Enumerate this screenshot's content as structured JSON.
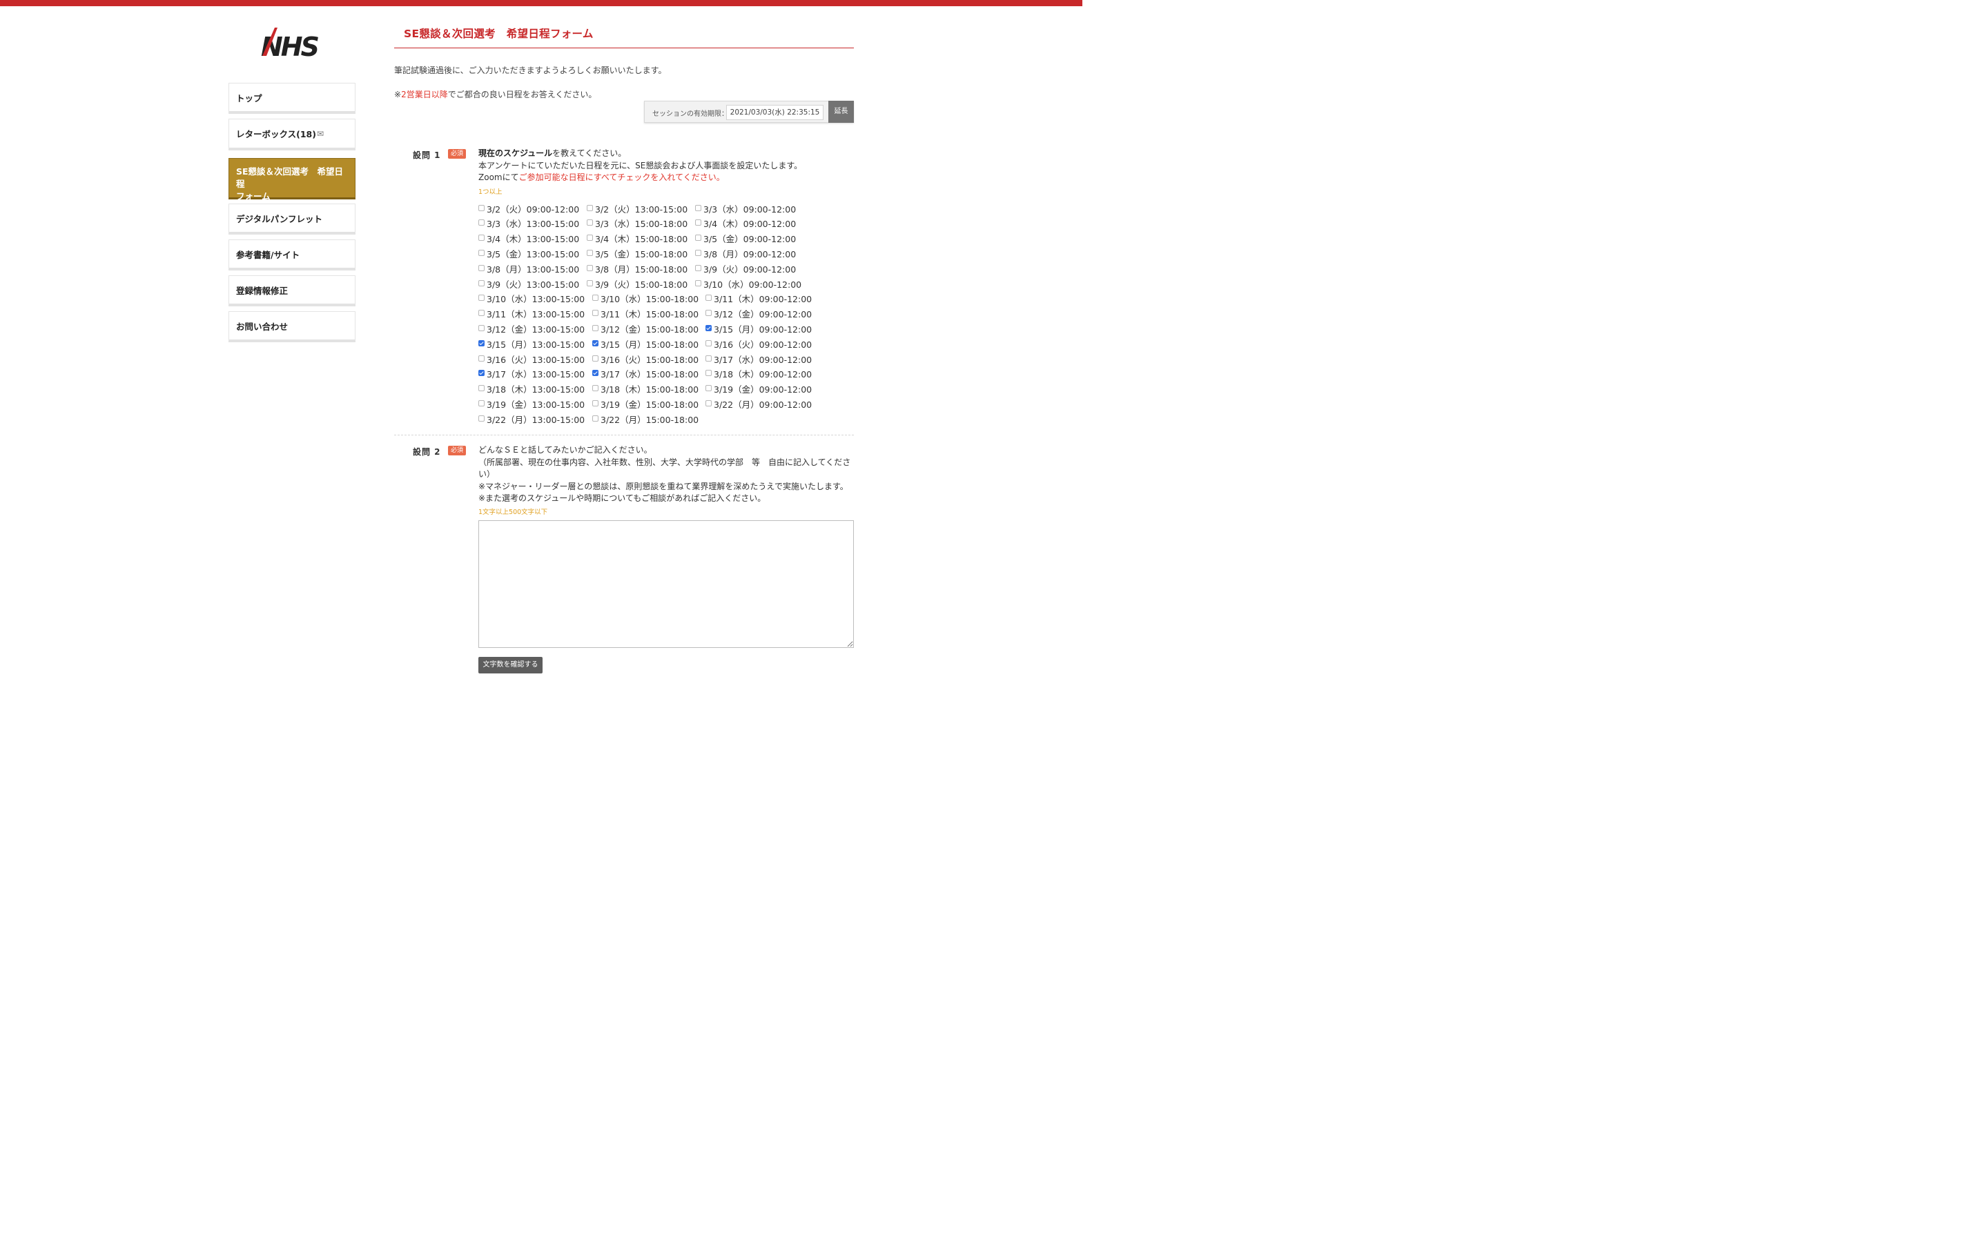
{
  "brand": {
    "logo_text": "NHS",
    "accent": "#c8282a",
    "active_nav": "#b38b28"
  },
  "sidebar": {
    "items": [
      {
        "label": "トップ"
      },
      {
        "label": "レターボックス(18)",
        "icon": "envelope-icon",
        "icon_glyph": "✉"
      },
      {
        "label_line1": "SE懇談＆次回選考　希望日程",
        "label_line2": "フォーム",
        "active": true
      },
      {
        "label": "デジタルパンフレット"
      },
      {
        "label": "参考書籍/サイト"
      },
      {
        "label": "登録情報修正"
      },
      {
        "label": "お問い合わせ"
      }
    ]
  },
  "main": {
    "title": "SE懇談＆次回選考　希望日程フォーム",
    "intro1": "筆記試験通過後に、ご入力いただきますようよろしくお願いいたします。",
    "intro2_prefix": "※",
    "intro2_red": "2営業日以降",
    "intro2_suffix": "でご都合の良い日程をお答えください。",
    "session": {
      "label": "セッションの有効期限：",
      "time": "2021/03/03(水) 22:35:15",
      "extend": "延長"
    },
    "q1": {
      "label": "設問 1",
      "required": "必須",
      "line1_bold": "現在のスケジュール",
      "line1_rest": "を教えてください。",
      "line2": "本アンケートにていただいた日程を元に、SE懇談会および人事面談を設定いたします。",
      "line3_prefix": "Zoomにて",
      "line3_red": "ご参加可能な日程にすべてチェックを入れてください。",
      "hint": "1つ以上",
      "options": [
        {
          "label": "3/2（火）09:00-12:00",
          "checked": false
        },
        {
          "label": "3/2（火）13:00-15:00",
          "checked": false
        },
        {
          "label": "3/3（水）09:00-12:00",
          "checked": false
        },
        {
          "label": "3/3（水）13:00-15:00",
          "checked": false
        },
        {
          "label": "3/3（水）15:00-18:00",
          "checked": false
        },
        {
          "label": "3/4（木）09:00-12:00",
          "checked": false
        },
        {
          "label": "3/4（木）13:00-15:00",
          "checked": false
        },
        {
          "label": "3/4（木）15:00-18:00",
          "checked": false
        },
        {
          "label": "3/5（金）09:00-12:00",
          "checked": false
        },
        {
          "label": "3/5（金）13:00-15:00",
          "checked": false
        },
        {
          "label": "3/5（金）15:00-18:00",
          "checked": false
        },
        {
          "label": "3/8（月）09:00-12:00",
          "checked": false
        },
        {
          "label": "3/8（月）13:00-15:00",
          "checked": false
        },
        {
          "label": "3/8（月）15:00-18:00",
          "checked": false
        },
        {
          "label": "3/9（火）09:00-12:00",
          "checked": false
        },
        {
          "label": "3/9（火）13:00-15:00",
          "checked": false
        },
        {
          "label": "3/9（火）15:00-18:00",
          "checked": false
        },
        {
          "label": "3/10（水）09:00-12:00",
          "checked": false
        },
        {
          "label": "3/10（水）13:00-15:00",
          "checked": false
        },
        {
          "label": "3/10（水）15:00-18:00",
          "checked": false
        },
        {
          "label": "3/11（木）09:00-12:00",
          "checked": false
        },
        {
          "label": "3/11（木）13:00-15:00",
          "checked": false
        },
        {
          "label": "3/11（木）15:00-18:00",
          "checked": false
        },
        {
          "label": "3/12（金）09:00-12:00",
          "checked": false
        },
        {
          "label": "3/12（金）13:00-15:00",
          "checked": false
        },
        {
          "label": "3/12（金）15:00-18:00",
          "checked": false
        },
        {
          "label": "3/15（月）09:00-12:00",
          "checked": true
        },
        {
          "label": "3/15（月）13:00-15:00",
          "checked": true
        },
        {
          "label": "3/15（月）15:00-18:00",
          "checked": true
        },
        {
          "label": "3/16（火）09:00-12:00",
          "checked": false
        },
        {
          "label": "3/16（火）13:00-15:00",
          "checked": false
        },
        {
          "label": "3/16（火）15:00-18:00",
          "checked": false
        },
        {
          "label": "3/17（水）09:00-12:00",
          "checked": false
        },
        {
          "label": "3/17（水）13:00-15:00",
          "checked": true
        },
        {
          "label": "3/17（水）15:00-18:00",
          "checked": true
        },
        {
          "label": "3/18（木）09:00-12:00",
          "checked": false
        },
        {
          "label": "3/18（木）13:00-15:00",
          "checked": false
        },
        {
          "label": "3/18（木）15:00-18:00",
          "checked": false
        },
        {
          "label": "3/19（金）09:00-12:00",
          "checked": false
        },
        {
          "label": "3/19（金）13:00-15:00",
          "checked": false
        },
        {
          "label": "3/19（金）15:00-18:00",
          "checked": false
        },
        {
          "label": "3/22（月）09:00-12:00",
          "checked": false
        },
        {
          "label": "3/22（月）13:00-15:00",
          "checked": false
        },
        {
          "label": "3/22（月）15:00-18:00",
          "checked": false
        }
      ]
    },
    "q2": {
      "label": "設問 2",
      "required": "必須",
      "line1": "どんなＳＥと話してみたいかご記入ください。",
      "line2": "（所属部署、現在の仕事内容、入社年数、性別、大学、大学時代の学部　等　自由に記入してください）",
      "line3": "※マネジャー・リーダー層との懇談は、原則懇談を重ねて業界理解を深めたうえで実施いたします。",
      "line4": "※また選考のスケジュールや時期についてもご相談があればご記入ください。",
      "hint": "1文字以上500文字以下",
      "value": "",
      "check_button": "文字数を確認する"
    }
  }
}
